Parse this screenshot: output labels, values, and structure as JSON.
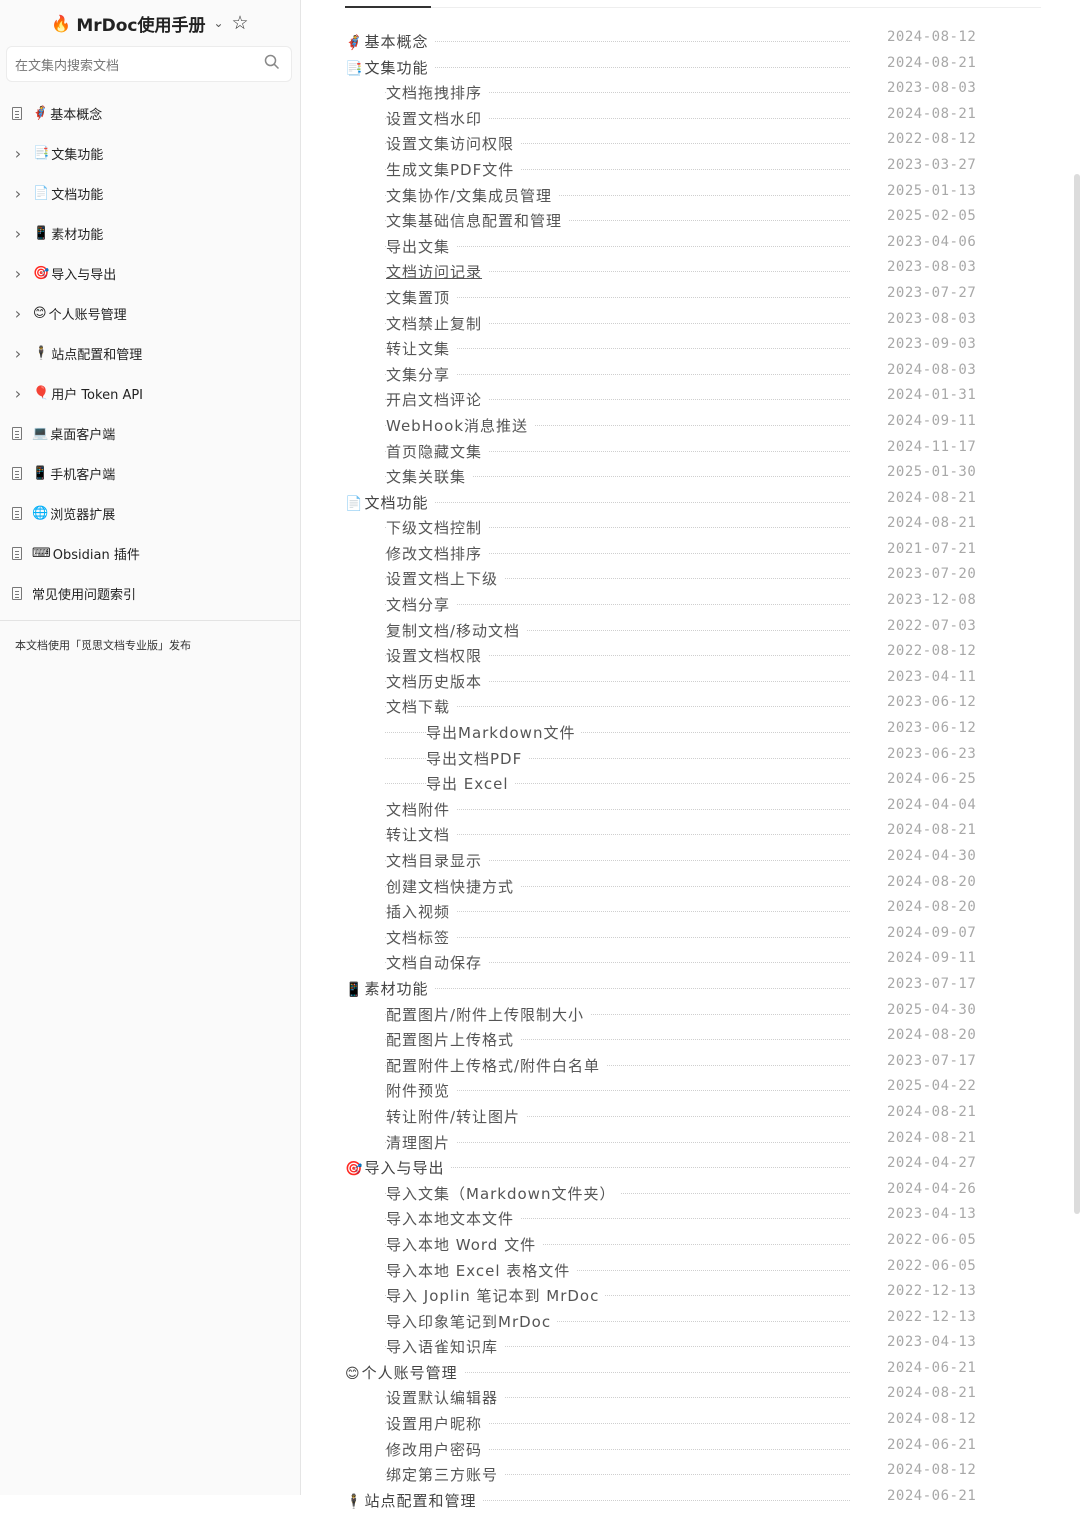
{
  "sidebar": {
    "title": "MrDoc使用手册",
    "brand_icon": "flame-icon",
    "search_placeholder": "在文集内搜索文档",
    "items": [
      {
        "label": "基本概念",
        "emoji": "🦸",
        "expandable": false
      },
      {
        "label": "文集功能",
        "emoji": "📑",
        "expandable": true
      },
      {
        "label": "文档功能",
        "emoji": "📄",
        "expandable": true
      },
      {
        "label": "素材功能",
        "emoji": "📱",
        "expandable": true
      },
      {
        "label": "导入与导出",
        "emoji": "🎯",
        "expandable": true
      },
      {
        "label": "个人账号管理",
        "emoji": "😊",
        "expandable": true
      },
      {
        "label": "站点配置和管理",
        "emoji": "🕴",
        "expandable": true
      },
      {
        "label": "用户 Token API",
        "emoji": "🎈",
        "expandable": true
      },
      {
        "label": "桌面客户端",
        "emoji": "💻",
        "expandable": false
      },
      {
        "label": "手机客户端",
        "emoji": "📱",
        "expandable": false
      },
      {
        "label": "浏览器扩展",
        "emoji": "🌐",
        "expandable": false
      },
      {
        "label": "Obsidian 插件",
        "emoji": "⌨",
        "expandable": false
      },
      {
        "label": "常见使用问题索引",
        "emoji": "",
        "expandable": false
      }
    ],
    "footer": "本文档使用「觅思文档专业版」发布"
  },
  "toc": [
    {
      "label": "基本概念",
      "emoji": "🦸",
      "date": "2024-08-12",
      "level": 0
    },
    {
      "label": "文集功能",
      "emoji": "📑",
      "date": "2024-08-21",
      "level": 0
    },
    {
      "label": "文档拖拽排序",
      "date": "2023-08-03",
      "level": 1
    },
    {
      "label": "设置文档水印",
      "date": "2024-08-21",
      "level": 1
    },
    {
      "label": "设置文集访问权限",
      "date": "2022-08-12",
      "level": 1
    },
    {
      "label": "生成文集PDF文件",
      "date": "2023-03-27",
      "level": 1
    },
    {
      "label": "文集协作/文集成员管理",
      "date": "2025-01-13",
      "level": 1
    },
    {
      "label": "文集基础信息配置和管理",
      "date": "2025-02-05",
      "level": 1
    },
    {
      "label": "导出文集",
      "date": "2023-04-06",
      "level": 1
    },
    {
      "label": "文档访问记录",
      "date": "2023-08-03",
      "level": 1,
      "underline": true
    },
    {
      "label": "文集置顶",
      "date": "2023-07-27",
      "level": 1
    },
    {
      "label": "文档禁止复制",
      "date": "2023-08-03",
      "level": 1
    },
    {
      "label": "转让文集",
      "date": "2023-09-03",
      "level": 1
    },
    {
      "label": "文集分享",
      "date": "2024-08-03",
      "level": 1
    },
    {
      "label": "开启文档评论",
      "date": "2024-01-31",
      "level": 1
    },
    {
      "label": "WebHook消息推送",
      "date": "2024-09-11",
      "level": 1
    },
    {
      "label": "首页隐藏文集",
      "date": "2024-11-17",
      "level": 1
    },
    {
      "label": "文集关联集",
      "date": "2025-01-30",
      "level": 1
    },
    {
      "label": "文档功能",
      "emoji": "📄",
      "date": "2024-08-21",
      "level": 0
    },
    {
      "label": "下级文档控制",
      "date": "2024-08-21",
      "level": 1
    },
    {
      "label": "修改文档排序",
      "date": "2021-07-21",
      "level": 1
    },
    {
      "label": "设置文档上下级",
      "date": "2023-07-20",
      "level": 1
    },
    {
      "label": "文档分享",
      "date": "2023-12-08",
      "level": 1
    },
    {
      "label": "复制文档/移动文档",
      "date": "2022-07-03",
      "level": 1
    },
    {
      "label": "设置文档权限",
      "date": "2022-08-12",
      "level": 1
    },
    {
      "label": "文档历史版本",
      "date": "2023-04-11",
      "level": 1
    },
    {
      "label": "文档下载",
      "date": "2023-06-12",
      "level": 1
    },
    {
      "label": "导出Markdown文件",
      "date": "2023-06-12",
      "level": 2
    },
    {
      "label": "导出文档PDF",
      "date": "2023-06-23",
      "level": 2
    },
    {
      "label": "导出 Excel",
      "date": "2024-06-25",
      "level": 2
    },
    {
      "label": "文档附件",
      "date": "2024-04-04",
      "level": 1
    },
    {
      "label": "转让文档",
      "date": "2024-08-21",
      "level": 1
    },
    {
      "label": "文档目录显示",
      "date": "2024-04-30",
      "level": 1
    },
    {
      "label": "创建文档快捷方式",
      "date": "2024-08-20",
      "level": 1
    },
    {
      "label": "插入视频",
      "date": "2024-08-20",
      "level": 1
    },
    {
      "label": "文档标签",
      "date": "2024-09-07",
      "level": 1
    },
    {
      "label": "文档自动保存",
      "date": "2024-09-11",
      "level": 1
    },
    {
      "label": "素材功能",
      "emoji": "📱",
      "date": "2023-07-17",
      "level": 0
    },
    {
      "label": "配置图片/附件上传限制大小",
      "date": "2025-04-30",
      "level": 1
    },
    {
      "label": "配置图片上传格式",
      "date": "2024-08-20",
      "level": 1
    },
    {
      "label": "配置附件上传格式/附件白名单",
      "date": "2023-07-17",
      "level": 1
    },
    {
      "label": "附件预览",
      "date": "2025-04-22",
      "level": 1
    },
    {
      "label": "转让附件/转让图片",
      "date": "2024-08-21",
      "level": 1
    },
    {
      "label": "清理图片",
      "date": "2024-08-21",
      "level": 1
    },
    {
      "label": "导入与导出",
      "emoji": "🎯",
      "date": "2024-04-27",
      "level": 0
    },
    {
      "label": "导入文集（Markdown文件夹）",
      "date": "2024-04-26",
      "level": 1
    },
    {
      "label": "导入本地文本文件",
      "date": "2023-04-13",
      "level": 1
    },
    {
      "label": "导入本地 Word 文件",
      "date": "2022-06-05",
      "level": 1
    },
    {
      "label": "导入本地 Excel 表格文件",
      "date": "2022-06-05",
      "level": 1
    },
    {
      "label": "导入 Joplin 笔记本到 MrDoc",
      "date": "2022-12-13",
      "level": 1
    },
    {
      "label": "导入印象笔记到MrDoc",
      "date": "2022-12-13",
      "level": 1
    },
    {
      "label": "导入语雀知识库",
      "date": "2023-04-13",
      "level": 1
    },
    {
      "label": "个人账号管理",
      "emoji": "😊",
      "date": "2024-06-21",
      "level": 0
    },
    {
      "label": "设置默认编辑器",
      "date": "2024-08-21",
      "level": 1
    },
    {
      "label": "设置用户昵称",
      "date": "2024-08-12",
      "level": 1
    },
    {
      "label": "修改用户密码",
      "date": "2024-06-21",
      "level": 1
    },
    {
      "label": "绑定第三方账号",
      "date": "2024-08-12",
      "level": 1
    },
    {
      "label": "站点配置和管理",
      "emoji": "🕴",
      "date": "2024-06-21",
      "level": 0
    }
  ]
}
